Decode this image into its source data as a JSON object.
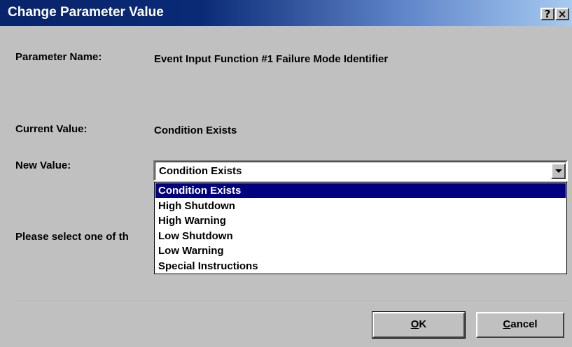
{
  "window": {
    "title": "Change Parameter Value",
    "help_label": "?",
    "close_label": "×"
  },
  "form": {
    "parameter_name_label": "Parameter Name:",
    "parameter_name_value": "Event Input Function #1 Failure Mode Identifier",
    "current_value_label": "Current Value:",
    "current_value": "Condition Exists",
    "new_value_label": "New Value:",
    "prompt_text": "Please select one of th"
  },
  "combo": {
    "selected": "Condition Exists",
    "options": [
      "Condition Exists",
      "High Shutdown",
      "High Warning",
      "Low Shutdown",
      "Low Warning",
      "Special Instructions"
    ],
    "highlighted_index": 0
  },
  "buttons": {
    "ok_mnemonic": "O",
    "ok_rest": "K",
    "cancel_mnemonic": "C",
    "cancel_rest": "ancel"
  },
  "icons": {
    "dropdown_arrow": "chevron-down-icon"
  }
}
